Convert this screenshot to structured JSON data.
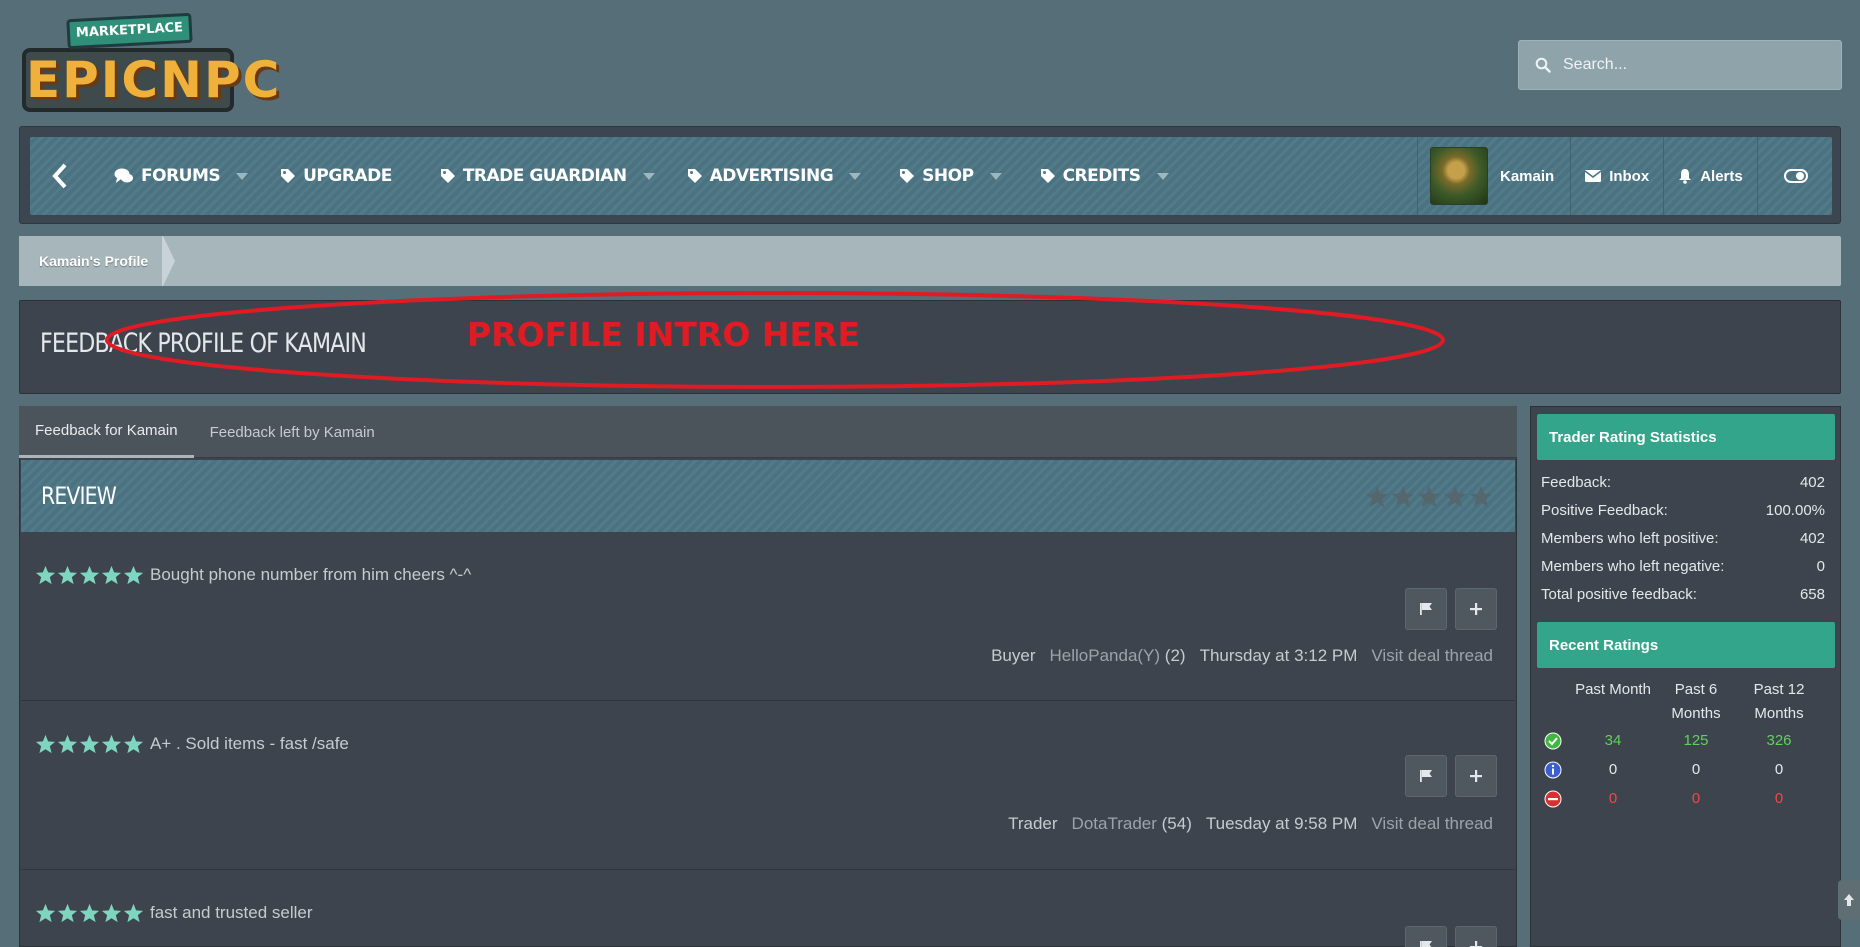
{
  "logo": {
    "banner": "MARKETPLACE",
    "main": "EPICNPC"
  },
  "search": {
    "placeholder": "Search..."
  },
  "nav": {
    "items": [
      {
        "label": "FORUMS",
        "icon": "comments-icon",
        "caret": true
      },
      {
        "label": "UPGRADE",
        "icon": "tag-icon",
        "caret": false
      },
      {
        "label": "TRADE GUARDIAN",
        "icon": "tag-icon",
        "caret": true
      },
      {
        "label": "ADVERTISING",
        "icon": "tag-icon",
        "caret": true
      },
      {
        "label": "SHOP",
        "icon": "tag-icon",
        "caret": true
      },
      {
        "label": "CREDITS",
        "icon": "tag-icon",
        "caret": true
      }
    ],
    "user": "Kamain",
    "inbox": "Inbox",
    "alerts": "Alerts"
  },
  "breadcrumb": {
    "item": "Kamain's Profile"
  },
  "page": {
    "title": "FEEDBACK PROFILE OF KAMAIN",
    "annotation": "PROFILE INTRO HERE"
  },
  "tabs": [
    {
      "label": "Feedback for Kamain",
      "active": true
    },
    {
      "label": "Feedback left by Kamain",
      "active": false
    }
  ],
  "review": {
    "title": "REVIEW"
  },
  "feedback": [
    {
      "stars": 5,
      "text": "Bought phone number from him cheers ^-^",
      "role": "Buyer",
      "user": "HelloPanda(Y)",
      "count": "(2)",
      "date": "Thursday at 3:12 PM",
      "link": "Visit deal thread"
    },
    {
      "stars": 5,
      "text": "A+ . Sold items - fast /safe",
      "role": "Trader",
      "user": "DotaTrader",
      "count": "(54)",
      "date": "Tuesday at 9:58 PM",
      "link": "Visit deal thread"
    },
    {
      "stars": 5,
      "text": "fast and trusted seller",
      "role": "",
      "user": "",
      "count": "",
      "date": "",
      "link": ""
    }
  ],
  "stats": {
    "title": "Trader Rating Statistics",
    "rows": [
      {
        "label": "Feedback:",
        "value": "402"
      },
      {
        "label": "Positive Feedback:",
        "value": "100.00%"
      },
      {
        "label": "Members who left positive:",
        "value": "402"
      },
      {
        "label": "Members who left negative:",
        "value": "0"
      },
      {
        "label": "Total positive feedback:",
        "value": "658"
      }
    ]
  },
  "recent": {
    "title": "Recent Ratings",
    "headers": [
      "Past Month",
      "Past 6 Months",
      "Past 12 Months"
    ],
    "rows": [
      {
        "type": "positive",
        "icon": "check-circle-icon",
        "values": [
          "34",
          "125",
          "326"
        ]
      },
      {
        "type": "neutral",
        "icon": "info-circle-icon",
        "values": [
          "0",
          "0",
          "0"
        ]
      },
      {
        "type": "negative",
        "icon": "minus-circle-icon",
        "values": [
          "0",
          "0",
          "0"
        ]
      }
    ]
  },
  "colors": {
    "accent": "#33a58a",
    "nav": "#4c7684",
    "star": "#7fd6c0",
    "annotation": "#e01b24"
  }
}
